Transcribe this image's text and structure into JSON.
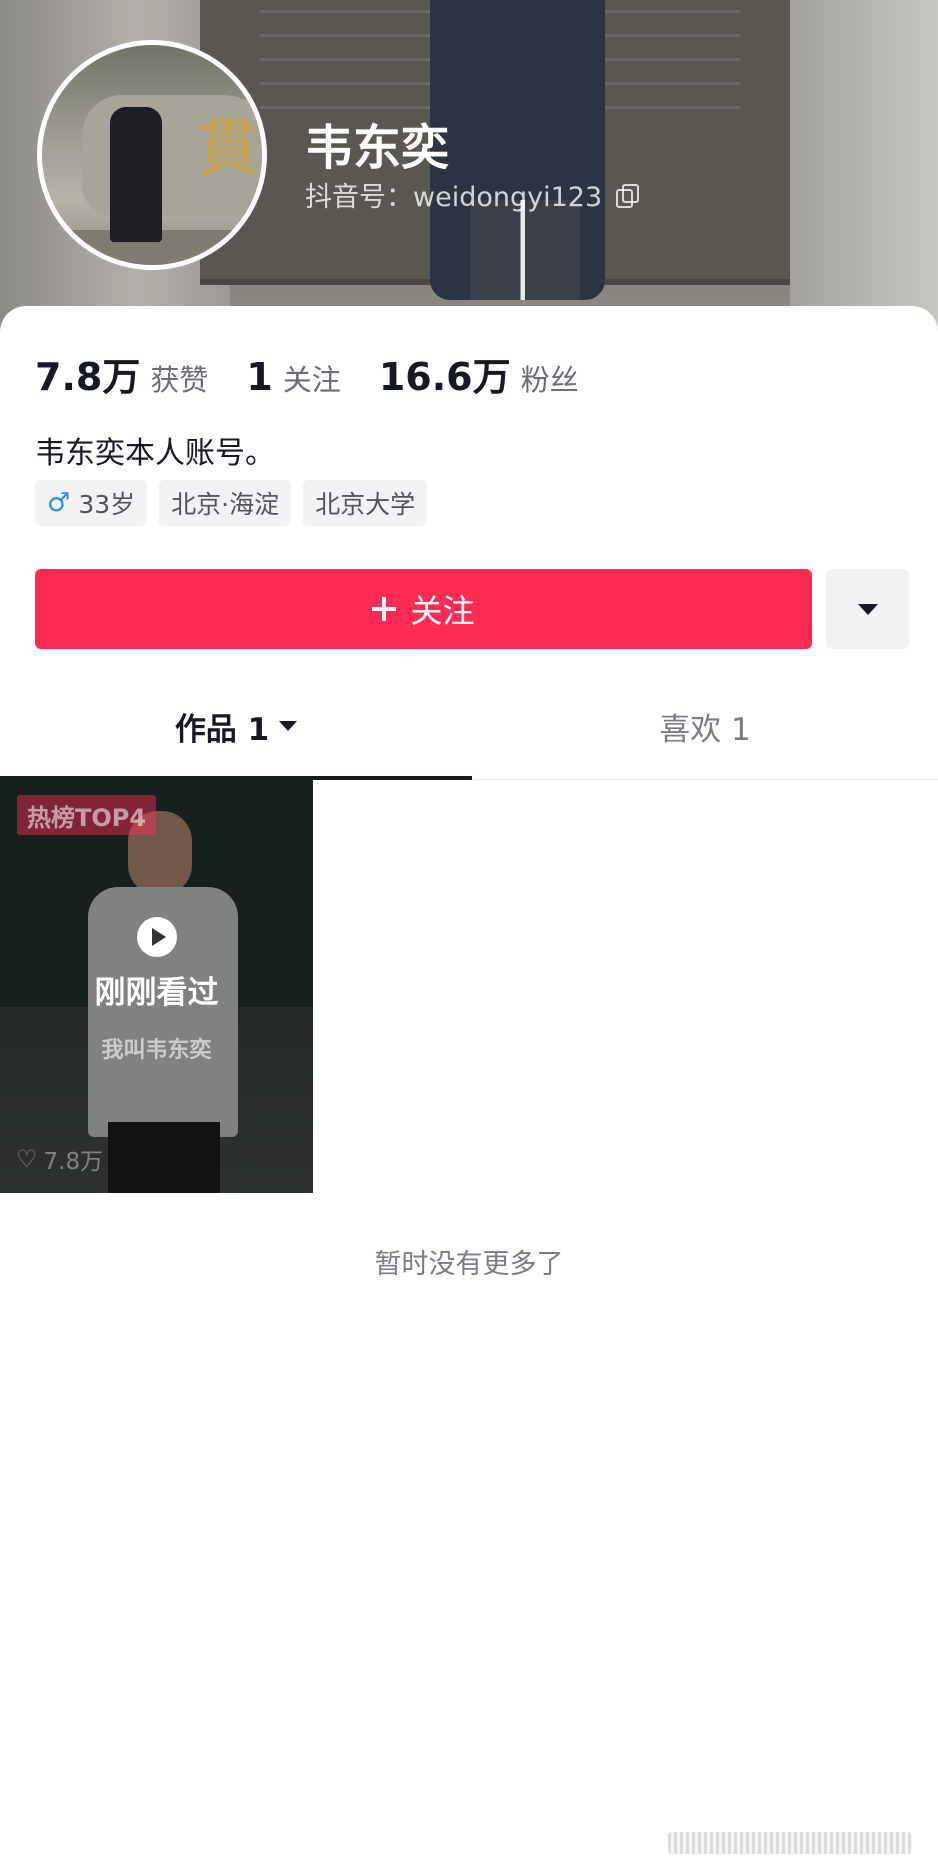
{
  "profile": {
    "name": "韦东奕",
    "douyin_id": "抖音号：weidongyi123",
    "bio": "韦东奕本人账号。"
  },
  "stats": [
    {
      "value": "7.8万",
      "label": "获赞"
    },
    {
      "value": "1",
      "label": "关注"
    },
    {
      "value": "16.6万",
      "label": "粉丝"
    }
  ],
  "tags": {
    "age": "33岁",
    "location": "北京·海淀",
    "school": "北京大学"
  },
  "actions": {
    "follow_label": "关注"
  },
  "tabs": {
    "works": "作品 1",
    "likes": "喜欢 1"
  },
  "video": {
    "badge": "热榜TOP4",
    "status": "刚刚看过",
    "caption": "我叫韦东奕",
    "likes": "7.8万"
  },
  "footer": {
    "no_more": "暂时没有更多了"
  },
  "colors": {
    "accent": "#fe2c55",
    "male": "#2b8ee8"
  }
}
